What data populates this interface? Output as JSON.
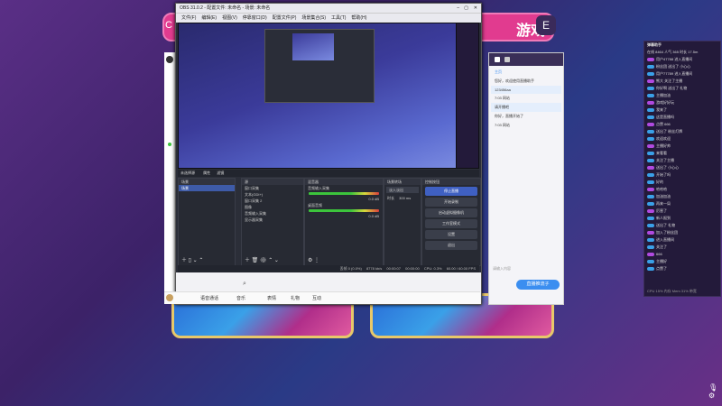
{
  "desktop": {
    "banner_title": "游戏",
    "left_letter": "C",
    "right_letter": "E"
  },
  "obs": {
    "title": "OBS 31.0.2 - 配置文件: 未命名 - 场景: 未命名",
    "menu": [
      "文件(F)",
      "编辑(E)",
      "视图(V)",
      "停靠窗口(D)",
      "配置文件(P)",
      "场景集合(S)",
      "工具(T)",
      "帮助(H)"
    ],
    "scene_tabs": [
      "场景",
      "属性",
      "滤镜"
    ],
    "scene_label": "未选择源",
    "docks": {
      "scenes": {
        "title": "场景",
        "items": [
          "场景"
        ]
      },
      "sources": {
        "title": "源",
        "items": [
          "窗口采集",
          "文本(GDI+)",
          "窗口采集 2",
          "图像",
          "音频输入采集",
          "显示器采集"
        ]
      },
      "mixer": {
        "title": "混音器",
        "tracks": [
          {
            "name": "音频输入采集",
            "db": "0.0 dB"
          },
          {
            "name": "桌面音频",
            "db": "0.0 dB"
          }
        ]
      },
      "transitions": {
        "title": "场景转场",
        "type": "淡入淡出",
        "duration_label": "时长",
        "duration": "300 ms"
      },
      "controls": {
        "title": "控制按钮",
        "buttons": [
          "停止直播",
          "开始录制",
          "启动虚拟摄像机",
          "工作室模式",
          "设置",
          "退出"
        ]
      }
    },
    "status": {
      "dropped": "丢帧 0 (0.0%)",
      "kbps": "8778 kb/s",
      "live_time": "00:00:07",
      "rec_time": "00:00:00",
      "cpu": "CPU: 0.3%",
      "fps": "60.00 / 60.00 FPS"
    }
  },
  "chat": {
    "tabs": [
      "主页",
      "消息"
    ],
    "messages": [
      "您好，欢迎使用直播助手",
      "123456aa",
      "7:03 网站",
      "请开播吧",
      "你好，直播开始了",
      "7:03 网站"
    ],
    "input_placeholder": "请输入内容",
    "send_label": "直播推流子"
  },
  "danmaku": {
    "title": "弹幕助手",
    "stats": [
      "在线 8464",
      "人气 365",
      "时长 17.5m"
    ],
    "lines": [
      "用户47788 进入直播间",
      "粉丝团 送出了 小心心",
      "用户77789 进入直播间",
      "熊大 关注了主播",
      "你好啊 送出了 礼物",
      "主播加油",
      "游戏好好玩",
      "我来了",
      "这是直播吗",
      "点赞 666",
      "送出了 粉丝灯牌",
      "欢迎欢迎",
      "主播好帅",
      "来看看",
      "关注了主播",
      "送出了 小心心",
      "开始了吗",
      "好的",
      "哈哈哈",
      "加油加油",
      "再来一局",
      "厉害了",
      "新人报到",
      "送出了 礼物",
      "加入了粉丝团",
      "进入直播间",
      "关注了",
      "666",
      "主播好",
      "点赞了"
    ],
    "footer": "CPU 15%  内存 Mem 31% 带宽"
  },
  "bottom_bar": {
    "items": [
      "语音通话",
      "音乐",
      "表情",
      "礼物",
      "互动"
    ]
  },
  "colors": {
    "accent": "#e13b8f",
    "obs_bg": "#2b2e38",
    "send_blue": "#3b8ef0"
  }
}
